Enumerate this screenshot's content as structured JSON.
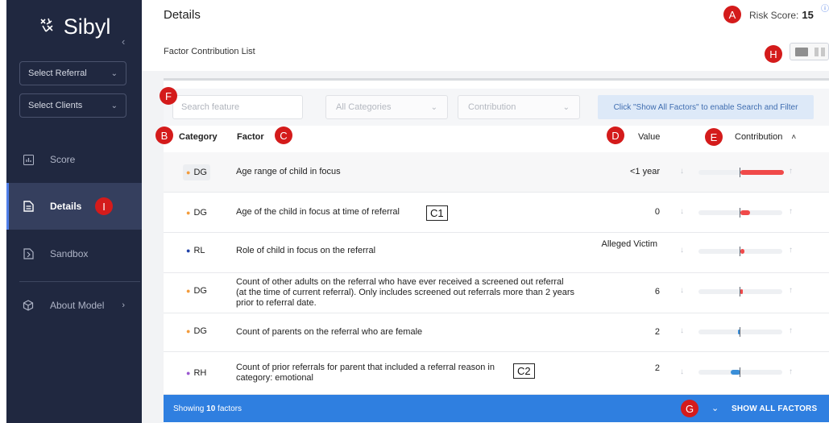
{
  "app": {
    "name": "Sibyl",
    "collapse_icon": "chevron-left-icon"
  },
  "sidebar": {
    "selects": [
      {
        "label": "Select Referral",
        "icon": "chevron-down-icon"
      },
      {
        "label": "Select Clients",
        "icon": "chevron-down-icon"
      }
    ],
    "nav": [
      {
        "label": "Score",
        "icon": "bar-chart-icon"
      },
      {
        "label": "Details",
        "icon": "document-icon",
        "active": true
      },
      {
        "label": "Sandbox",
        "icon": "sandbox-icon"
      },
      {
        "label": "About Model",
        "icon": "cube-icon"
      }
    ]
  },
  "header": {
    "title": "Details",
    "risk_label": "Risk Score:",
    "risk_value": "15",
    "subtitle": "Factor Contribution List"
  },
  "filters": {
    "search_placeholder": "Search feature",
    "category_select": "All Categories",
    "sort_select": "Contribution",
    "hint": "Click \"Show All Factors\" to enable Search and Filter"
  },
  "table": {
    "headers": {
      "category": "Category",
      "factor": "Factor",
      "value": "Value",
      "contribution": "Contribution"
    },
    "sort_icon": "chevron-up-icon",
    "rows": [
      {
        "category": "DG",
        "dot_color": "#f39c3d",
        "factor": "Age range of child in focus",
        "value": "<1 year",
        "contribution": 0.52,
        "bar_color": "#f04a4a"
      },
      {
        "category": "DG",
        "dot_color": "#f39c3d",
        "factor": "Age of the child in focus at time of referral",
        "value": "0",
        "contribution": 0.12,
        "bar_color": "#f04a4a"
      },
      {
        "category": "RL",
        "dot_color": "#2142a8",
        "factor": "Role of child in focus on the referral",
        "value": "Alleged Victim",
        "contribution": 0.05,
        "bar_color": "#f04a4a"
      },
      {
        "category": "DG",
        "dot_color": "#f39c3d",
        "factor": "Count of other adults on the referral who have ever received a screened out referral (at the time of current referral). Only includes screened out referrals more than 2 years prior to referral date.",
        "value": "6",
        "contribution": 0.03,
        "bar_color": "#f04a4a"
      },
      {
        "category": "DG",
        "dot_color": "#f39c3d",
        "factor": "Count of parents on the referral who are female",
        "value": "2",
        "contribution": -0.03,
        "bar_color": "#3b8fd8"
      },
      {
        "category": "RH",
        "dot_color": "#9b59d0",
        "factor": "Count of prior referrals for parent that included a referral reason in category: emotional",
        "value": "2",
        "contribution": -0.12,
        "bar_color": "#3b8fd8"
      }
    ]
  },
  "footer": {
    "showing_prefix": "Showing ",
    "showing_count": "10",
    "showing_suffix": " factors",
    "show_all": "SHOW ALL FACTORS",
    "expand_icon": "chevron-down-icon"
  },
  "annotations": {
    "markers": [
      "A",
      "B",
      "C",
      "D",
      "E",
      "F",
      "G",
      "H",
      "I"
    ],
    "boxes": [
      "C1",
      "C2"
    ]
  },
  "colors": {
    "sidebar_bg": "#202840",
    "accent": "#2f7fe0",
    "marker": "#d41b1b"
  }
}
